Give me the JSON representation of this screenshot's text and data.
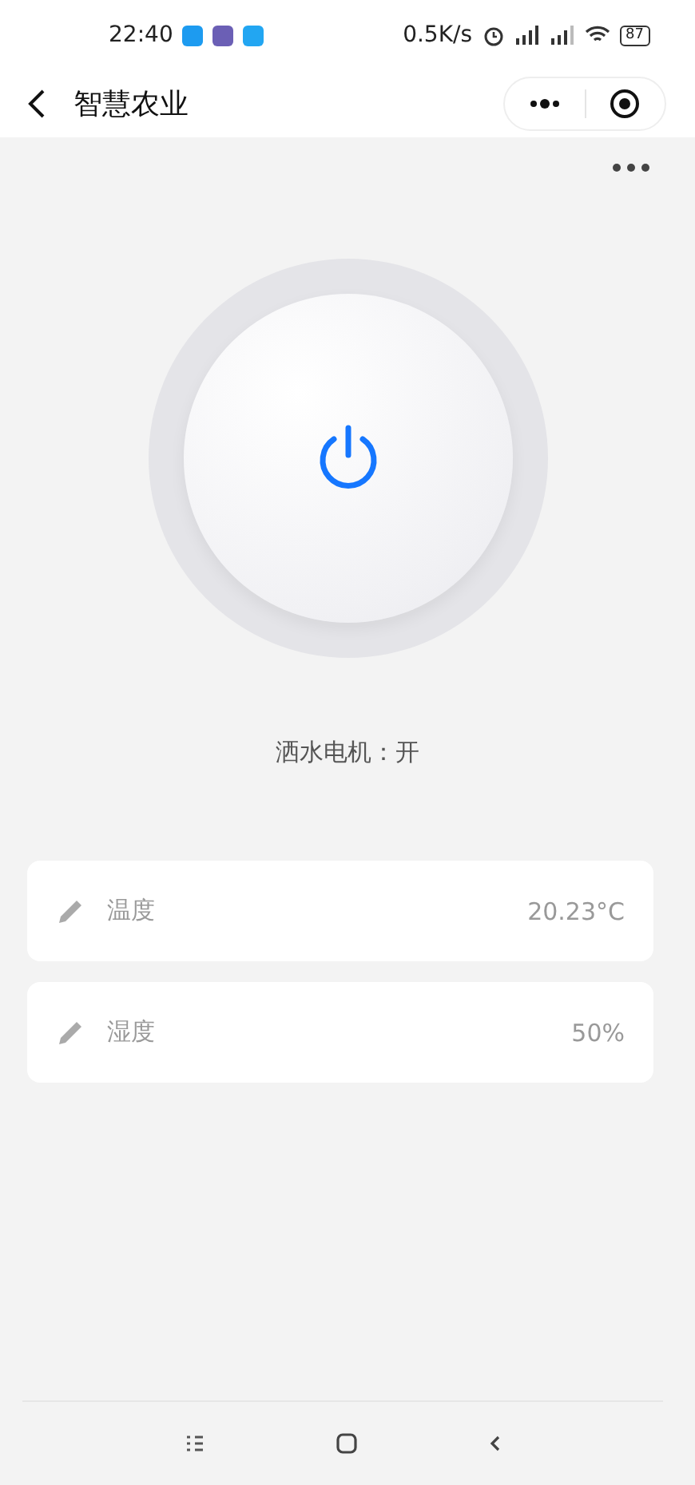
{
  "status_bar": {
    "time": "22:40",
    "network_speed": "0.5K/s",
    "battery": "87"
  },
  "nav": {
    "title": "智慧农业"
  },
  "motor": {
    "label": "洒水电机：开",
    "on": true
  },
  "readings": [
    {
      "name": "温度",
      "value": "20.23°C"
    },
    {
      "name": "湿度",
      "value": "50%"
    }
  ]
}
